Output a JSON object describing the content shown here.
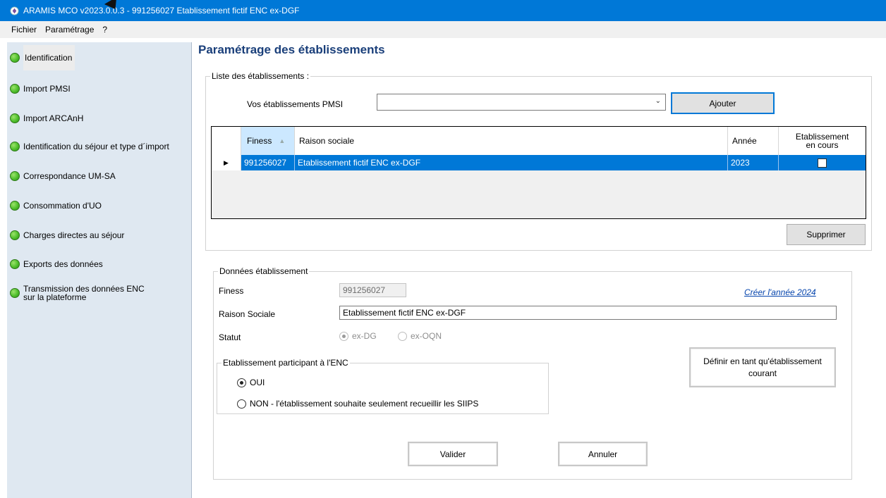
{
  "window": {
    "title": "ARAMIS MCO v2023.0.0.3  -  991256027  Etablissement fictif ENC ex-DGF"
  },
  "menu": [
    "Fichier",
    "Paramétrage",
    "?"
  ],
  "sidebar": {
    "items": [
      {
        "label": "Identification",
        "active": true
      },
      {
        "label": "Import PMSI"
      },
      {
        "label": "Import ARCAnH"
      },
      {
        "label": "Identification du séjour et type d´import"
      },
      {
        "label": "Correspondance UM-SA"
      },
      {
        "label": "Consommation d'UO"
      },
      {
        "label": "Charges directes au séjour"
      },
      {
        "label": "Exports des données"
      },
      {
        "label": "Transmission des données ENC sur la plateforme"
      }
    ]
  },
  "main": {
    "title": "Paramétrage des établissements",
    "liste": {
      "legend": "Liste des établissements :",
      "pmsi_label": "Vos établissements PMSI",
      "pmsi_value": "",
      "add_button": "Ajouter",
      "delete_button": "Supprimer",
      "columns": [
        "Finess",
        "Raison sociale",
        "Année",
        "Etablissement en cours"
      ],
      "rows": [
        {
          "finess": "991256027",
          "raison": "Etablissement fictif ENC ex-DGF",
          "annee": "2023",
          "en_cours": false
        }
      ]
    },
    "donnees": {
      "legend": "Données établissement",
      "finess_label": "Finess",
      "finess_value": "991256027",
      "create_year_link": "Créer l'année 2024",
      "raison_label": "Raison Sociale",
      "raison_value": "Etablissement fictif ENC ex-DGF",
      "statut_label": "Statut",
      "statut_options": [
        "ex-DG",
        "ex-OQN"
      ],
      "statut_selected": "ex-DG",
      "enc": {
        "legend": "Etablissement participant à l'ENC",
        "options": [
          "OUI",
          "NON - l'établissement souhaite seulement recueillir les SIIPS"
        ],
        "selected": "OUI"
      },
      "define_button": "Définir en tant qu'établissement courant",
      "validate_button": "Valider",
      "cancel_button": "Annuler"
    }
  },
  "colors": {
    "titlebar": "#0078d7",
    "sidebar": "#dfe8f1",
    "selection": "#0078d7",
    "title_text": "#1a3f7a",
    "status_ok": "#4fbf2c"
  }
}
